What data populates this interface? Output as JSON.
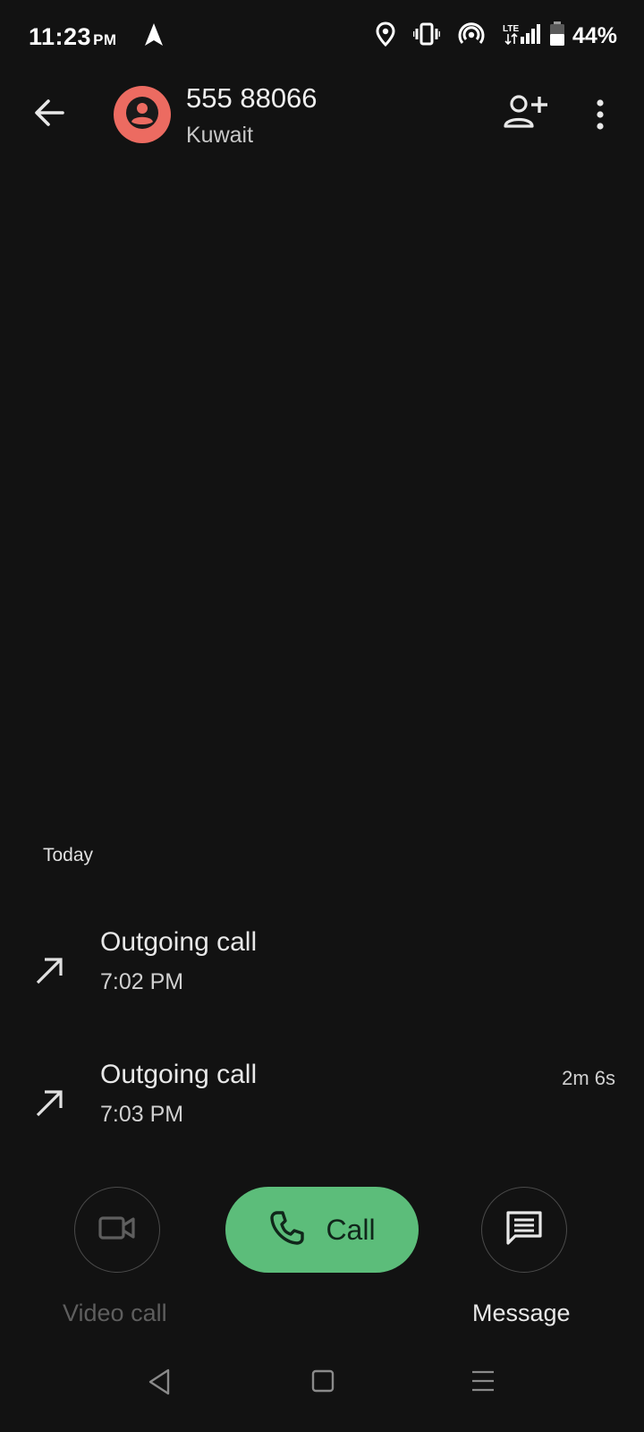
{
  "status_bar": {
    "time": "11:23",
    "ampm": "PM",
    "network": "LTE",
    "battery": "44%",
    "icons": [
      "navigation-arrow-icon",
      "location-icon",
      "vibrate-icon",
      "hotspot-icon",
      "lte-signal-icon",
      "battery-icon"
    ]
  },
  "header": {
    "back_icon": "arrow-left-icon",
    "contact_number": "555 88066",
    "contact_location": "Kuwait",
    "add_contact_icon": "person-add-icon",
    "more_icon": "more-vertical-icon",
    "avatar_color": "#ec6b61"
  },
  "history": {
    "section_label": "Today",
    "calls": [
      {
        "type": "Outgoing call",
        "time": "7:02 PM",
        "duration": "",
        "icon": "outgoing-arrow-icon"
      },
      {
        "type": "Outgoing call",
        "time": "7:03 PM",
        "duration": "2m 6s",
        "icon": "outgoing-arrow-icon"
      }
    ]
  },
  "actions": {
    "video_call_label": "Video call",
    "call_label": "Call",
    "message_label": "Message",
    "call_button_color": "#5cbd7a"
  },
  "nav_bar": {
    "icons": [
      "nav-back-icon",
      "nav-home-icon",
      "nav-recents-icon"
    ]
  }
}
